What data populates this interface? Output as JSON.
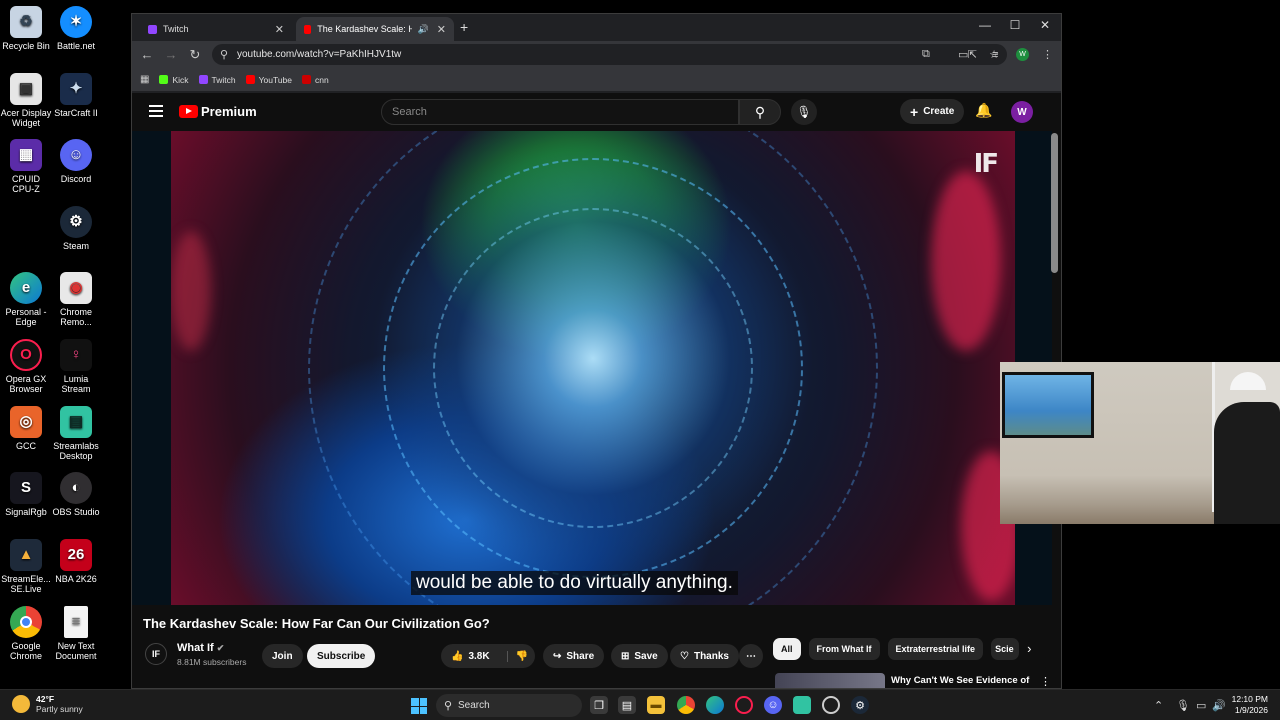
{
  "desktop": {
    "icons": [
      {
        "label": "Recycle Bin"
      },
      {
        "label": "Battle.net"
      },
      {
        "label": "Acer Display Widget"
      },
      {
        "label": "StarCraft II"
      },
      {
        "label": "CPUID CPU-Z"
      },
      {
        "label": "Discord"
      },
      {
        "label": "Steam"
      },
      {
        "label": "Personal - Edge"
      },
      {
        "label": "Chrome Remo..."
      },
      {
        "label": "Opera GX Browser"
      },
      {
        "label": "Lumia Stream"
      },
      {
        "label": "GCC"
      },
      {
        "label": "Streamlabs Desktop"
      },
      {
        "label": "SignalRgb"
      },
      {
        "label": "OBS Studio"
      },
      {
        "label": "StreamEle... SE.Live"
      },
      {
        "label": "NBA 2K26"
      },
      {
        "label": "Google Chrome"
      },
      {
        "label": "New Text Document"
      }
    ]
  },
  "browser": {
    "tabs": [
      {
        "label": "Twitch"
      },
      {
        "label": "The Kardashev Scale: How F"
      }
    ],
    "url": "youtube.com/watch?v=PaKhIHJV1tw",
    "profile_initial": "W",
    "bookmarks": [
      {
        "label": "Kick",
        "color": "#53fc18"
      },
      {
        "label": "Twitch",
        "color": "#9146ff"
      },
      {
        "label": "YouTube",
        "color": "#ff0000"
      },
      {
        "label": "cnn",
        "color": "#cc0000"
      }
    ]
  },
  "youtube": {
    "logo_text": "Premium",
    "search_placeholder": "Search",
    "create_label": "Create",
    "avatar_initial": "W",
    "video": {
      "caption": "would be able to do virtually anything.",
      "watermark": "IF",
      "title": "The Kardashev Scale: How Far Can Our Civilization Go?",
      "channel_name": "What If",
      "channel_initial": "IF",
      "subscribers": "8.81M subscribers",
      "join_label": "Join",
      "subscribe_label": "Subscribe",
      "likes": "3.8K",
      "share_label": "Share",
      "save_label": "Save",
      "thanks_label": "Thanks"
    },
    "chips": [
      "All",
      "From What If",
      "Extraterrestrial life",
      "Scie"
    ],
    "recommendation": {
      "title": "Why Can't We See Evidence of Alien Life? | Documentary"
    }
  },
  "taskbar": {
    "weather_temp": "42°F",
    "weather_desc": "Partly sunny",
    "search_label": "Search",
    "time": "12:10 PM",
    "date": "1/9/2026"
  }
}
